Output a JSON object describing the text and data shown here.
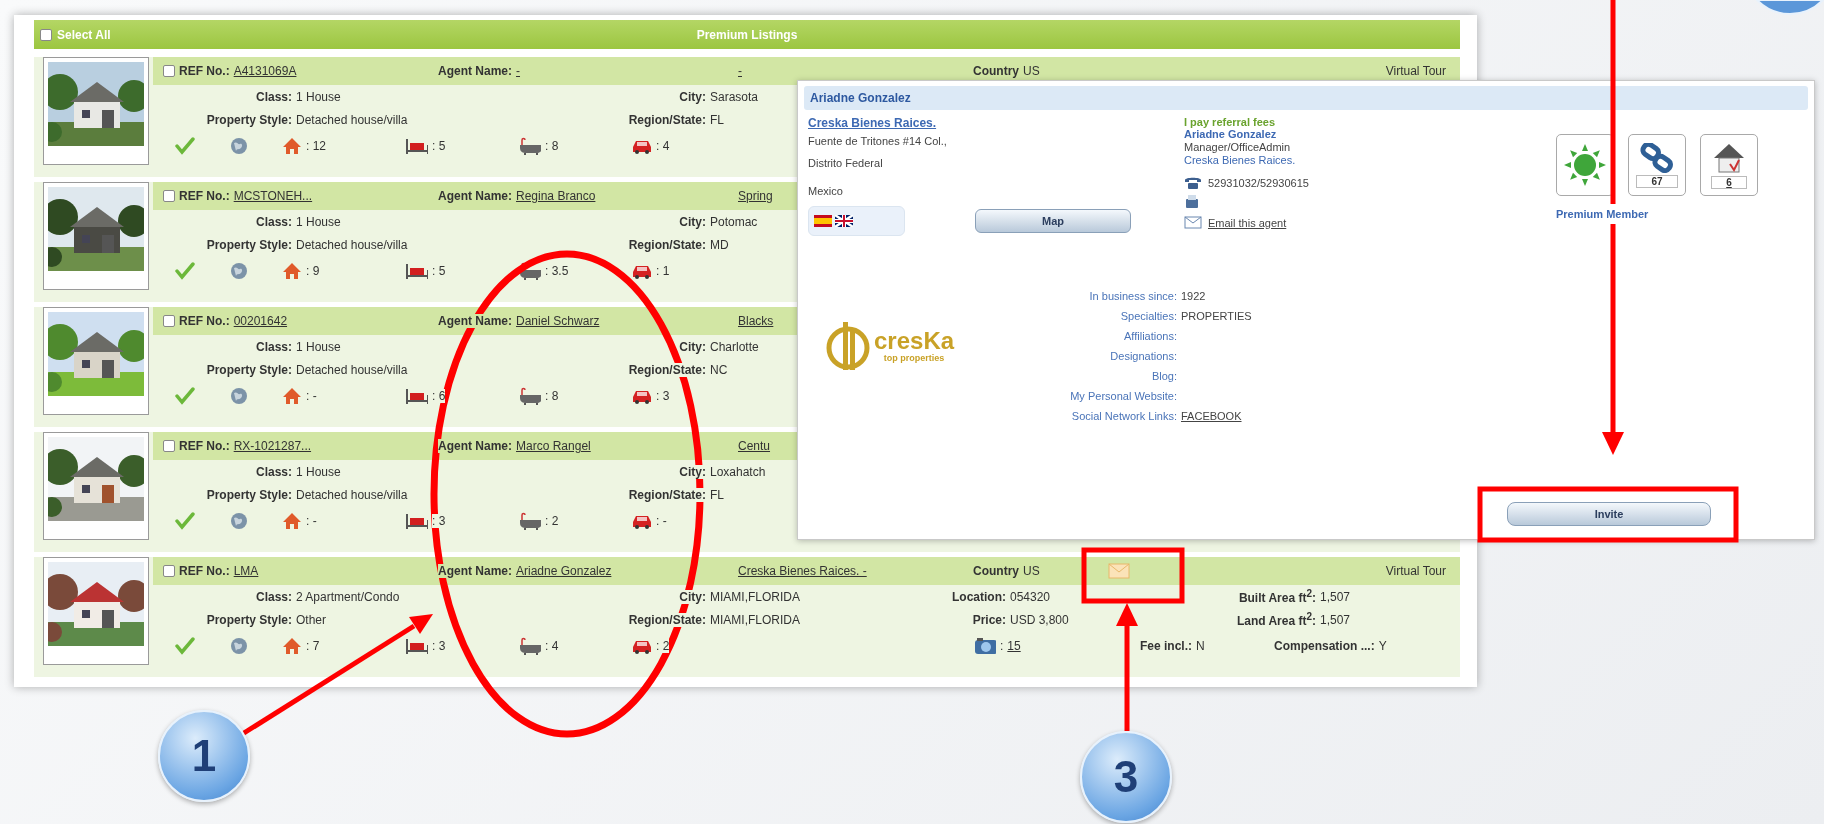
{
  "listing_panel": {
    "select_all": {
      "label": "Select All",
      "checked": false
    },
    "title": "Premium Listings",
    "rows": [
      {
        "checked": false,
        "ref_label": "REF No.:",
        "ref": "A4131069A",
        "agent_label": "Agent Name:",
        "agent": "-",
        "office": "-",
        "country_label": "Country",
        "country": "US",
        "virtual_tour": "Virtual Tour",
        "details": [
          [
            {
              "label": "Class:",
              "value": "1 House"
            },
            {
              "label": "City:",
              "value": "Sarasota"
            }
          ],
          [
            {
              "label": "Property Style:",
              "value": "Detached house/villa"
            },
            {
              "label": "Region/State:",
              "value": "FL"
            }
          ]
        ],
        "stats": {
          "rooms": ": 12",
          "beds": ": 5",
          "baths": ": 8",
          "cars": ": 4"
        }
      },
      {
        "checked": false,
        "ref_label": "REF No.:",
        "ref": "MCSTONEH...",
        "agent_label": "Agent Name:",
        "agent": "Regina Branco",
        "office": "Spring",
        "details": [
          [
            {
              "label": "Class:",
              "value": "1 House"
            },
            {
              "label": "City:",
              "value": "Potomac"
            }
          ],
          [
            {
              "label": "Property Style:",
              "value": "Detached house/villa"
            },
            {
              "label": "Region/State:",
              "value": "MD"
            }
          ]
        ],
        "stats": {
          "rooms": ": 9",
          "beds": ": 5",
          "baths": ": 3.5",
          "cars": ": 1"
        }
      },
      {
        "checked": false,
        "ref_label": "REF No.:",
        "ref": "00201642",
        "agent_label": "Agent Name:",
        "agent": "Daniel Schwarz",
        "office": "Blacks",
        "details": [
          [
            {
              "label": "Class:",
              "value": "1 House"
            },
            {
              "label": "City:",
              "value": "Charlotte"
            }
          ],
          [
            {
              "label": "Property Style:",
              "value": "Detached house/villa"
            },
            {
              "label": "Region/State:",
              "value": "NC"
            }
          ]
        ],
        "stats": {
          "rooms": ": -",
          "beds": ": 6",
          "baths": ": 8",
          "cars": ": 3"
        }
      },
      {
        "checked": false,
        "ref_label": "REF No.:",
        "ref": "RX-1021287...",
        "agent_label": "Agent Name:",
        "agent": "Marco Rangel",
        "office": "Centu",
        "details": [
          [
            {
              "label": "Class:",
              "value": "1 House"
            },
            {
              "label": "City:",
              "value": "Loxahatch"
            }
          ],
          [
            {
              "label": "Property Style:",
              "value": "Detached house/villa"
            },
            {
              "label": "Region/State:",
              "value": "FL"
            }
          ]
        ],
        "stats": {
          "rooms": ": -",
          "beds": ": 3",
          "baths": ": 2",
          "cars": ": -"
        }
      },
      {
        "checked": false,
        "ref_label": "REF No.:",
        "ref": "LMA",
        "agent_label": "Agent Name:",
        "agent": "Ariadne Gonzalez",
        "office": "Creska Bienes Raices. -",
        "country_label": "Country",
        "country": "US",
        "email": true,
        "virtual_tour": "Virtual Tour",
        "details": [
          [
            {
              "label": "Class:",
              "value": "2 Apartment/Condo"
            },
            {
              "label": "City:",
              "value": "MIAMI,FLORIDA"
            },
            {
              "label": "Location:",
              "value": "054320"
            },
            {
              "label": "Built Area ft$^{2}$:",
              "value": "1,507"
            }
          ],
          [
            {
              "label": "Property Style:",
              "value": "Other"
            },
            {
              "label": "Region/State:",
              "value": "MIAMI,FLORIDA"
            },
            {
              "label": "Price:",
              "value": "USD 3,800"
            },
            {
              "label": "Land Area ft$^{2}$:",
              "value": "1,507"
            }
          ]
        ],
        "stats": {
          "rooms": ": 7",
          "beds": ": 3",
          "baths": ": 4",
          "cars": ": 2"
        },
        "photos": {
          "prefix": ":",
          "count": "15"
        },
        "fee": {
          "label": "Fee incl.:",
          "value": "N"
        },
        "compensation": {
          "label": "Compensation ...:",
          "value": "Y"
        }
      }
    ]
  },
  "agent_popup": {
    "title": "Ariadne Gonzalez",
    "company": "Creska Bienes Raices.",
    "address": [
      "Fuente de Tritones #14 Col.,",
      "Distrito Federal"
    ],
    "country": "Mexico",
    "map_button": "Map",
    "referral": "I pay referral fees",
    "agent_name": "Ariadne Gonzalez",
    "role": "Manager/OfficeAdmin",
    "agency": "Creska Bienes Raices.",
    "phone": "52931032/52930615",
    "email_link": "Email this agent",
    "badges": [
      {
        "kind": "sun"
      },
      {
        "kind": "link",
        "count": "67"
      },
      {
        "kind": "house",
        "count": "6"
      }
    ],
    "member_label": "Premium Member",
    "logo": {
      "name": "cresKa",
      "tagline": "top properties"
    },
    "profile": [
      {
        "label": "In business since:",
        "value": "1922"
      },
      {
        "label": "Specialties:",
        "value": "PROPERTIES"
      },
      {
        "label": "Affiliations:"
      },
      {
        "label": "Designations:"
      },
      {
        "label": "Blog:"
      },
      {
        "label": "My Personal Website:"
      },
      {
        "label": "Social Network Links:",
        "value": "FACEBOOK",
        "link": true
      }
    ],
    "invite_button": "Invite"
  },
  "annotations": {
    "steps": [
      "1",
      "3"
    ]
  }
}
